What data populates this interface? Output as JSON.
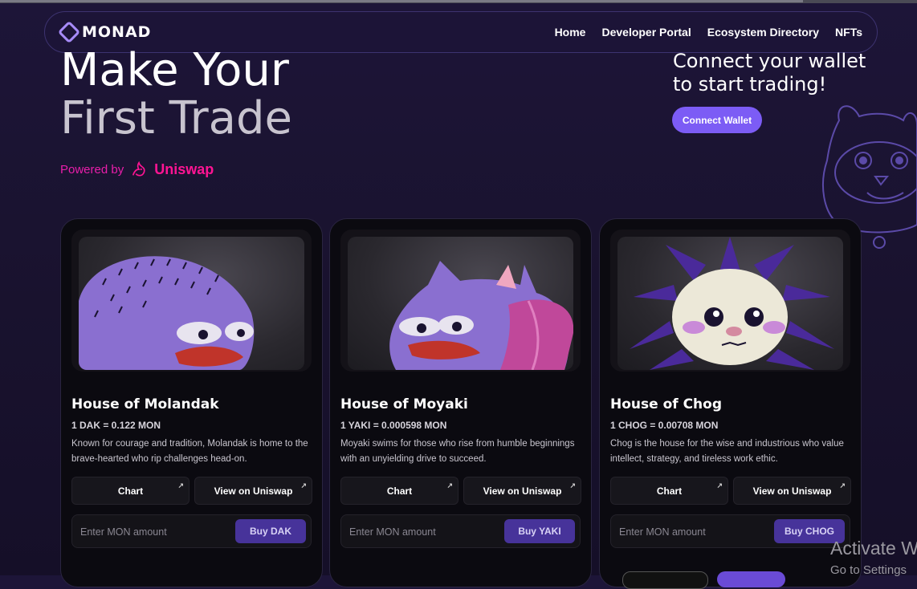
{
  "nav": {
    "logo": "MONAD",
    "links": [
      "Home",
      "Developer Portal",
      "Ecosystem Directory",
      "NFTs"
    ]
  },
  "hero": {
    "line1": "Make Your",
    "line2": "First Trade",
    "powered_by": "Powered by",
    "powered_brand": "Uniswap"
  },
  "wallet": {
    "text": "Connect your wallet to start trading!",
    "button": "Connect Wallet"
  },
  "cards": [
    {
      "title": "House of Molandak",
      "price": "1 DAK = 0.122 MON",
      "desc": "Known for courage and tradition, Molandak is home to the brave-hearted who rip challenges head-on.",
      "chart": "Chart",
      "uniswap": "View on Uniswap",
      "placeholder": "Enter MON amount",
      "buy": "Buy DAK"
    },
    {
      "title": "House of Moyaki",
      "price": "1 YAKI = 0.000598 MON",
      "desc": "Moyaki swims for those who rise from humble beginnings with an unyielding drive to succeed.",
      "chart": "Chart",
      "uniswap": "View on Uniswap",
      "placeholder": "Enter MON amount",
      "buy": "Buy YAKI"
    },
    {
      "title": "House of Chog",
      "price": "1 CHOG = 0.00708 MON",
      "desc": "Chog is the house for the wise and industrious who value intellect, strategy, and tireless work ethic.",
      "chart": "Chart",
      "uniswap": "View on Uniswap",
      "placeholder": "Enter MON amount",
      "buy": "Buy CHOG"
    }
  ],
  "watermark": {
    "line1": "Activate W",
    "line2": "Go to Settings"
  },
  "colors": {
    "accent": "#7c5cf5",
    "uniswap_pink": "#ff1493",
    "buy_button": "#47339a"
  }
}
